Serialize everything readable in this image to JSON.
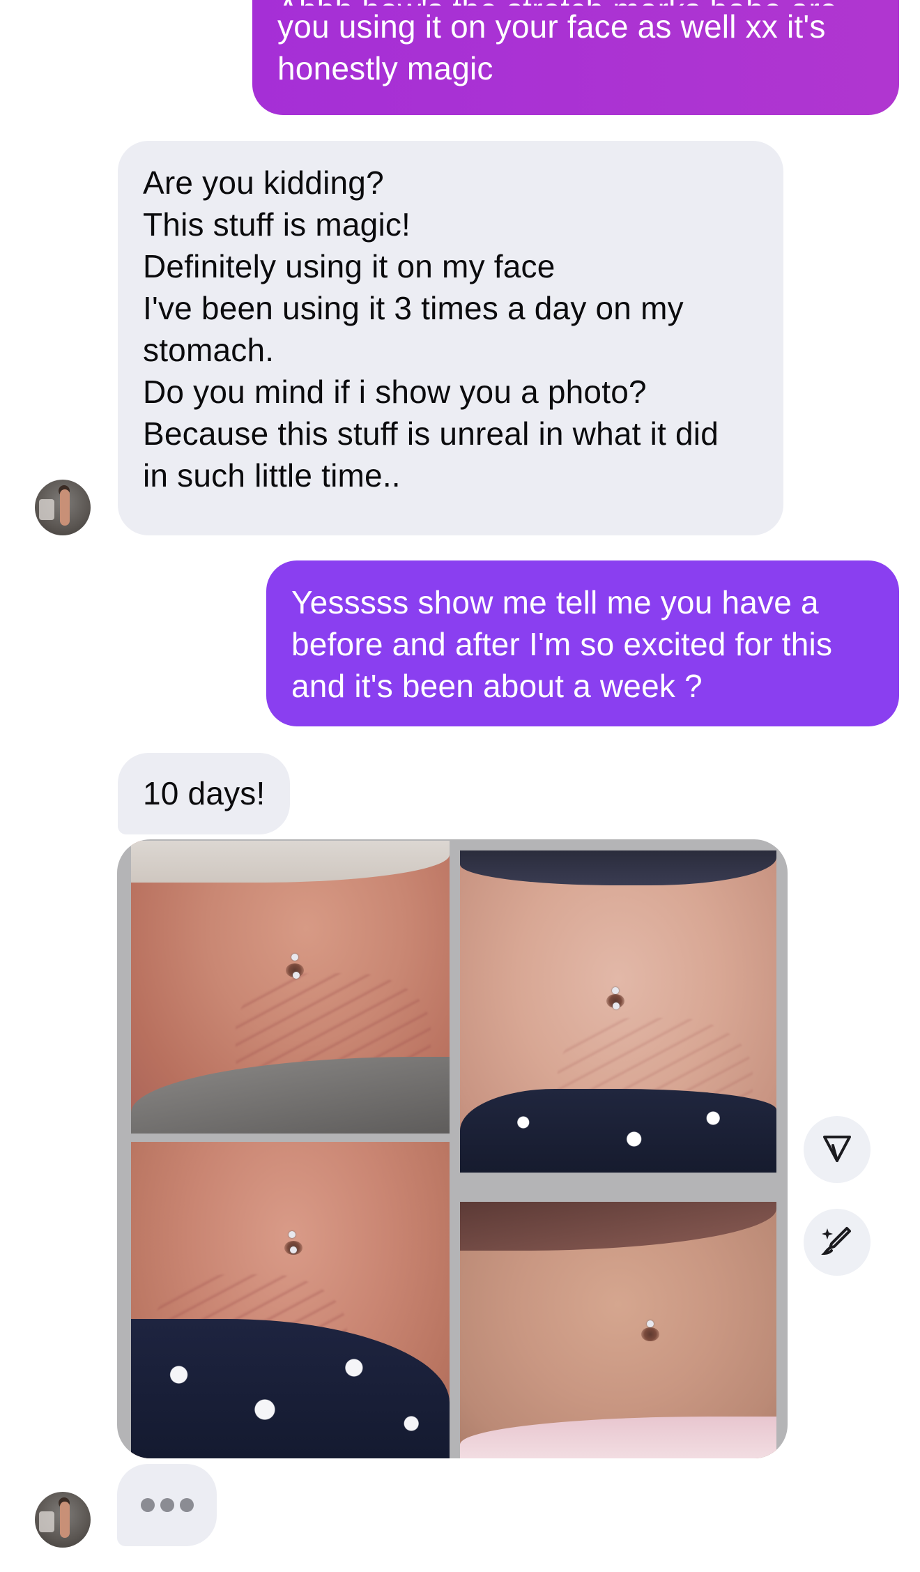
{
  "conversation": {
    "outgoing_1": {
      "cut_line": "Ahhh how's the stretch marks babe are",
      "lines": [
        "you using it on your face as well xx it's",
        "honestly magic"
      ]
    },
    "incoming_1": {
      "lines": [
        "Are you kidding?",
        "This stuff is magic!",
        "Definitely using it on my face",
        "I've been using it 3 times a day on my",
        "stomach.",
        "Do you mind if i show you a photo?",
        "Because this stuff is unreal in what it did",
        "in such little time.."
      ]
    },
    "outgoing_2": {
      "lines": [
        "Yesssss show me tell me you have a",
        "before and after I'm so excited for this",
        "and it's been about a week ?"
      ]
    },
    "incoming_2": {
      "text": "10 days!"
    },
    "photo_message": {
      "panels": [
        "before-top-left",
        "after-top-right",
        "before-bottom-left",
        "after-bottom-right"
      ]
    },
    "actions": {
      "share_icon": "paper-plane-icon",
      "edit_icon": "sparkle-brush-icon"
    },
    "typing_indicator": {
      "dots": 3
    }
  },
  "colors": {
    "outgoing_bubble_1": "#b036d0",
    "outgoing_bubble_2": "#8a3ff0",
    "incoming_bubble": "#ecedf3",
    "incoming_text": "#0b0b0d",
    "outgoing_text": "#ffffff"
  }
}
